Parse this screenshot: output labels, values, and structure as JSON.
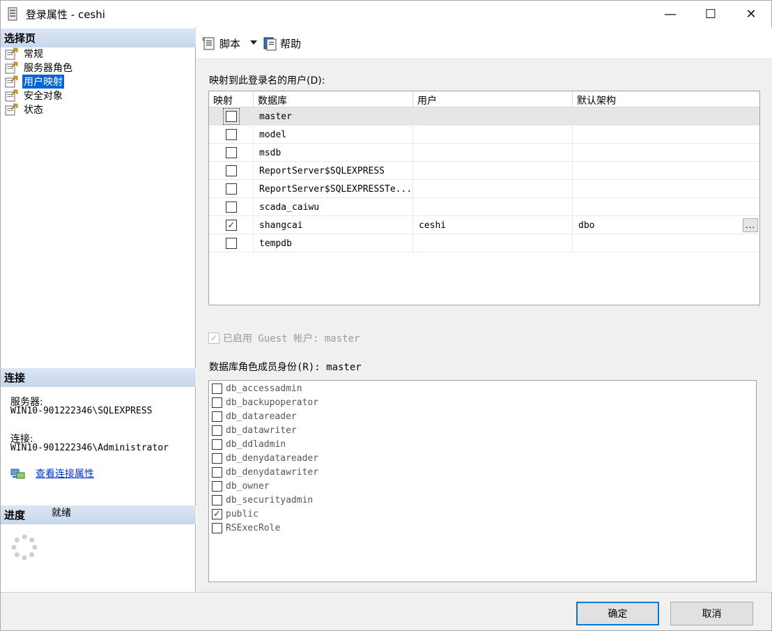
{
  "window": {
    "title": "登录属性 - ceshi",
    "minimize": "—",
    "maximize": "☐",
    "close": "✕"
  },
  "left": {
    "select_page_header": "选择页",
    "pages": [
      {
        "label": "常规",
        "selected": false
      },
      {
        "label": "服务器角色",
        "selected": false
      },
      {
        "label": "用户映射",
        "selected": true
      },
      {
        "label": "安全对象",
        "selected": false
      },
      {
        "label": "状态",
        "selected": false
      }
    ],
    "connection_header": "连接",
    "server_label": "服务器:",
    "server_value": "WIN10-901222346\\SQLEXPRESS",
    "connection_label": "连接:",
    "connection_value": "WIN10-901222346\\Administrator",
    "view_link": "查看连接属性",
    "progress_header": "进度",
    "progress_status": "就绪"
  },
  "toolbar": {
    "script_label": "脚本",
    "help_label": "帮助"
  },
  "mapping": {
    "label": "映射到此登录名的用户(D):",
    "columns": [
      "映射",
      "数据库",
      "用户",
      "默认架构"
    ],
    "rows": [
      {
        "mapped": false,
        "database": "master",
        "user": "",
        "schema": ""
      },
      {
        "mapped": false,
        "database": "model",
        "user": "",
        "schema": ""
      },
      {
        "mapped": false,
        "database": "msdb",
        "user": "",
        "schema": ""
      },
      {
        "mapped": false,
        "database": "ReportServer$SQLEXPRESS",
        "user": "",
        "schema": ""
      },
      {
        "mapped": false,
        "database": "ReportServer$SQLEXPRESSTe...",
        "user": "",
        "schema": ""
      },
      {
        "mapped": false,
        "database": "scada_caiwu",
        "user": "",
        "schema": ""
      },
      {
        "mapped": true,
        "database": "shangcai",
        "user": "ceshi",
        "schema": "dbo"
      },
      {
        "mapped": false,
        "database": "tempdb",
        "user": "",
        "schema": ""
      }
    ],
    "ellipsis": "..."
  },
  "guest": {
    "label": "已启用 Guest 帐户: master",
    "checked": true
  },
  "roles": {
    "label": "数据库角色成员身份(R): master",
    "items": [
      {
        "name": "db_accessadmin",
        "checked": false
      },
      {
        "name": "db_backupoperator",
        "checked": false
      },
      {
        "name": "db_datareader",
        "checked": false
      },
      {
        "name": "db_datawriter",
        "checked": false
      },
      {
        "name": "db_ddladmin",
        "checked": false
      },
      {
        "name": "db_denydatareader",
        "checked": false
      },
      {
        "name": "db_denydatawriter",
        "checked": false
      },
      {
        "name": "db_owner",
        "checked": false
      },
      {
        "name": "db_securityadmin",
        "checked": false
      },
      {
        "name": "public",
        "checked": true
      },
      {
        "name": "RSExecRole",
        "checked": false
      }
    ]
  },
  "buttons": {
    "ok": "确定",
    "cancel": "取消"
  },
  "colors": {
    "selection": "#0a64d6",
    "link": "#0033cc",
    "header_gradient": "#c7d7ec"
  }
}
